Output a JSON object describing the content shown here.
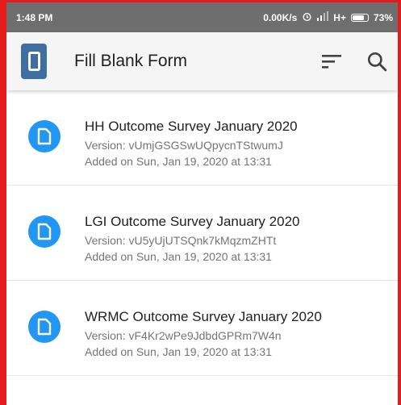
{
  "status_bar": {
    "time": "1:48 PM",
    "network_speed": "0.00K/s",
    "network_type": "H+",
    "battery": "73%"
  },
  "app_bar": {
    "title": "Fill Blank Form",
    "icons": [
      "app-logo-icon",
      "sort-icon",
      "search-icon"
    ]
  },
  "forms": [
    {
      "title": "HH Outcome Survey January 2020",
      "version": "Version: vUmjGSGSwUQpycnTStwumJ",
      "added": "Added on Sun, Jan 19, 2020 at 13:31"
    },
    {
      "title": "LGI Outcome Survey January 2020",
      "version": "Version: vU5yUjUTSQnk7kMqzmZHTt",
      "added": "Added on Sun, Jan 19, 2020 at 13:31"
    },
    {
      "title": "WRMC Outcome Survey January 2020",
      "version": "Version: vF4Kr2wPe9JdbdGPRm7W4n",
      "added": "Added on Sun, Jan 19, 2020 at 13:31"
    }
  ],
  "colors": {
    "accent": "#2196f3",
    "logo": "#3e6f9e",
    "status_bar": "#6e6e6e",
    "frame": "#e31b1b"
  }
}
